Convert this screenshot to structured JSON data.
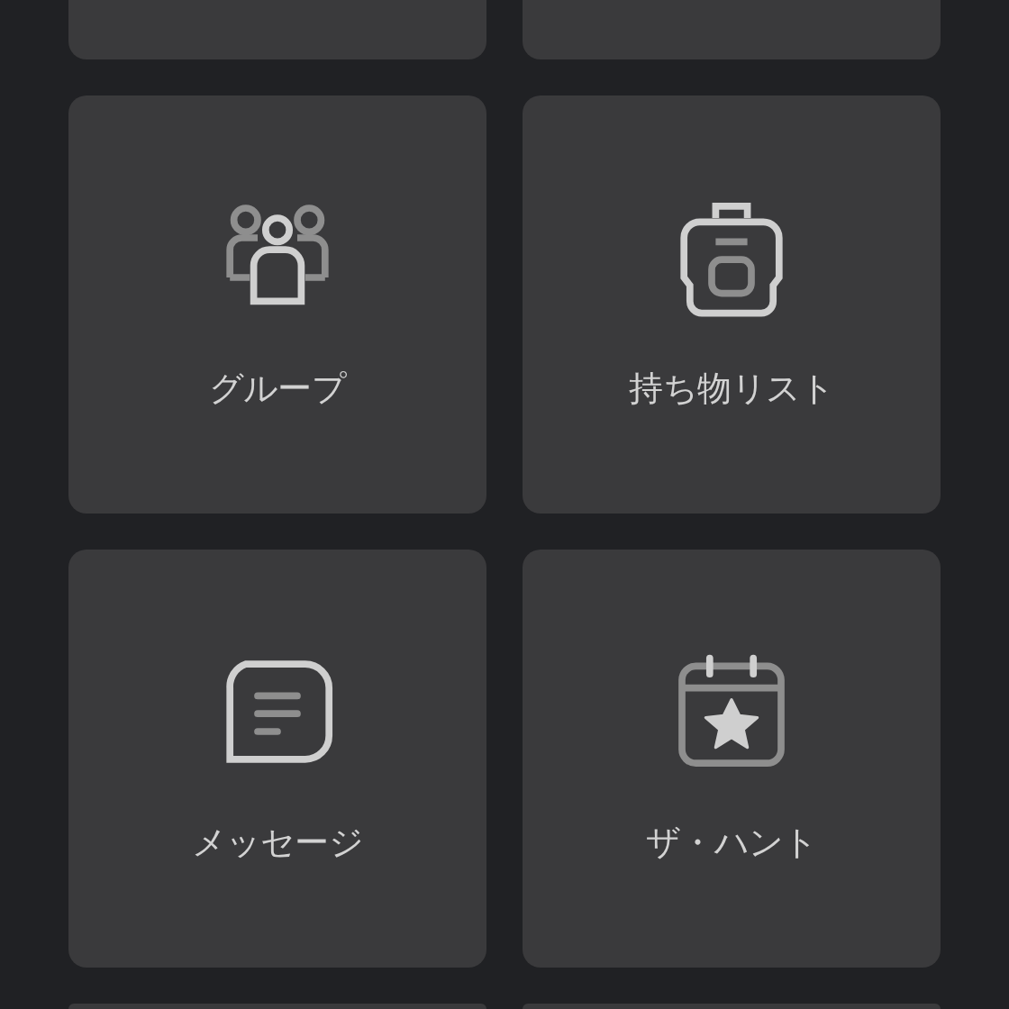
{
  "tiles": [
    {
      "kind": "group",
      "label": "グループ"
    },
    {
      "kind": "backpack",
      "label": "持ち物リスト"
    },
    {
      "kind": "message",
      "label": "メッセージ"
    },
    {
      "kind": "calendar",
      "label": "ザ・ハント"
    }
  ]
}
